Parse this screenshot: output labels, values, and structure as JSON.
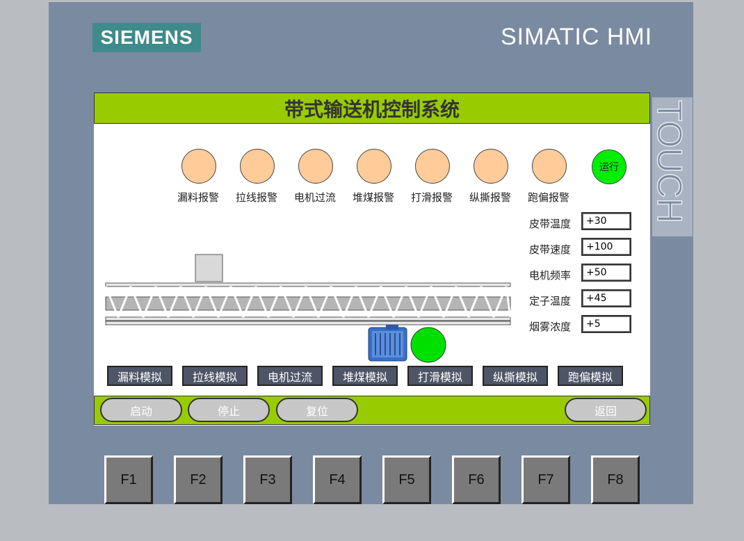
{
  "device": {
    "brand_logo": "SIEMENS",
    "model": "SIMATIC HMI",
    "touch_label": "TOUCH"
  },
  "screen": {
    "title": "带式输送机控制系统",
    "alarms": [
      {
        "label": "漏料报警"
      },
      {
        "label": "拉线报警"
      },
      {
        "label": "电机过流"
      },
      {
        "label": "堆煤报警"
      },
      {
        "label": "打滑报警"
      },
      {
        "label": "纵撕报警"
      },
      {
        "label": "跑偏报警"
      }
    ],
    "run_indicator": "运行",
    "params": [
      {
        "label": "皮带温度",
        "value": "+30"
      },
      {
        "label": "皮带速度",
        "value": "+100"
      },
      {
        "label": "电机频率",
        "value": "+50"
      },
      {
        "label": "定子温度",
        "value": "+45"
      },
      {
        "label": "烟雾浓度",
        "value": "+5"
      }
    ],
    "sim_buttons": [
      "漏料模拟",
      "拉线模拟",
      "电机过流",
      "堆煤模拟",
      "打滑模拟",
      "纵撕模拟",
      "跑偏模拟"
    ],
    "control_buttons": {
      "start": "启动",
      "stop": "停止",
      "reset": "复位",
      "back": "返回"
    }
  },
  "function_keys": [
    "F1",
    "F2",
    "F3",
    "F4",
    "F5",
    "F6",
    "F7",
    "F8"
  ],
  "colors": {
    "bezel": "#7a8aa1",
    "title_bar": "#99cc00",
    "alarm_lamp_off": "#ffcc99",
    "run_lamp_on": "#00ee00",
    "sim_button": "#4d5566"
  }
}
